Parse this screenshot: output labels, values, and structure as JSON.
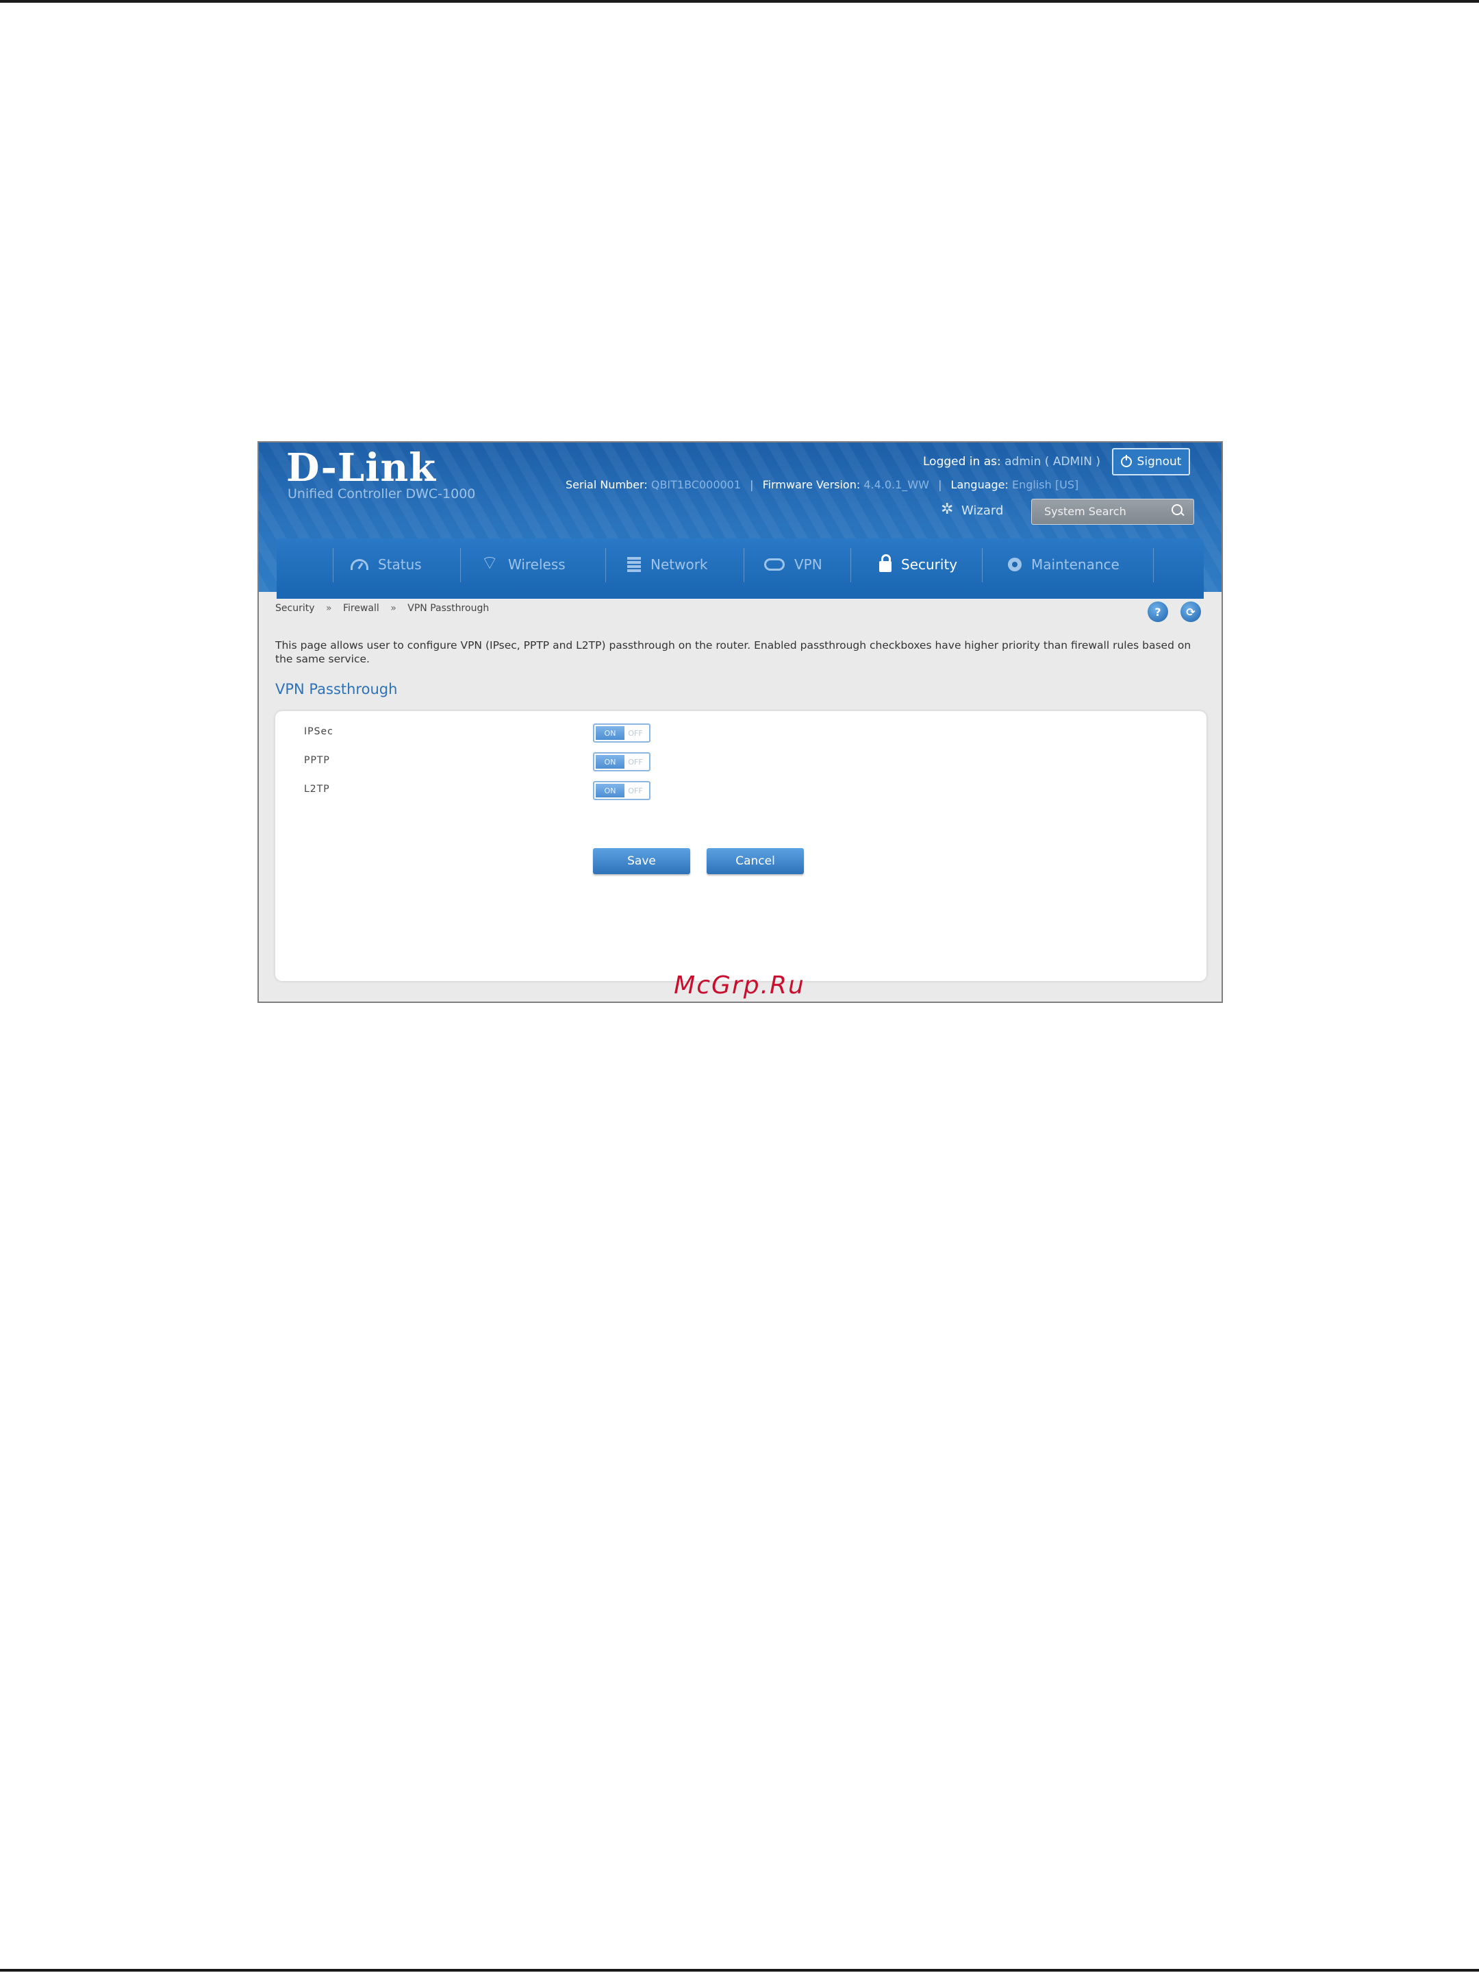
{
  "header": {
    "logo": "D-Link",
    "subtitle": "Unified Controller   DWC-1000",
    "logged_in_label": "Logged in as:",
    "logged_in_value": "admin ( ADMIN )",
    "signout_label": "Signout",
    "serial_label": "Serial Number:",
    "serial_value": "QBIT1BC000001",
    "firmware_label": "Firmware Version:",
    "firmware_value": "4.4.0.1_WW",
    "language_label": "Language:",
    "language_value": "English [US]",
    "wizard_label": "Wizard",
    "search_placeholder": "System Search"
  },
  "nav": {
    "items": [
      {
        "label": "Status",
        "icon": "dashboard-icon"
      },
      {
        "label": "Wireless",
        "icon": "wifi-icon"
      },
      {
        "label": "Network",
        "icon": "network-icon"
      },
      {
        "label": "VPN",
        "icon": "cloud-icon"
      },
      {
        "label": "Security",
        "icon": "lock-icon",
        "active": true
      },
      {
        "label": "Maintenance",
        "icon": "gear-icon"
      }
    ]
  },
  "breadcrumb": {
    "items": [
      "Security",
      "Firewall",
      "VPN Passthrough"
    ],
    "separator": "»"
  },
  "help_icons": [
    "?",
    "⟳"
  ],
  "description": "This page allows user to configure VPN (IPsec, PPTP and L2TP) passthrough on the router. Enabled passthrough checkboxes have higher priority than firewall rules based on the same service.",
  "section_title": "VPN Passthrough",
  "form": {
    "rows": [
      {
        "label": "IPSec",
        "on_label": "ON",
        "off_label": "OFF",
        "state": "on"
      },
      {
        "label": "PPTP",
        "on_label": "ON",
        "off_label": "OFF",
        "state": "on"
      },
      {
        "label": "L2TP",
        "on_label": "ON",
        "off_label": "OFF",
        "state": "on"
      }
    ],
    "save_label": "Save",
    "cancel_label": "Cancel"
  },
  "watermark": "McGrp.Ru",
  "colors": {
    "brand_blue": "#1d5fa8",
    "accent": "#2e72b8",
    "watermark": "#c8102e"
  }
}
